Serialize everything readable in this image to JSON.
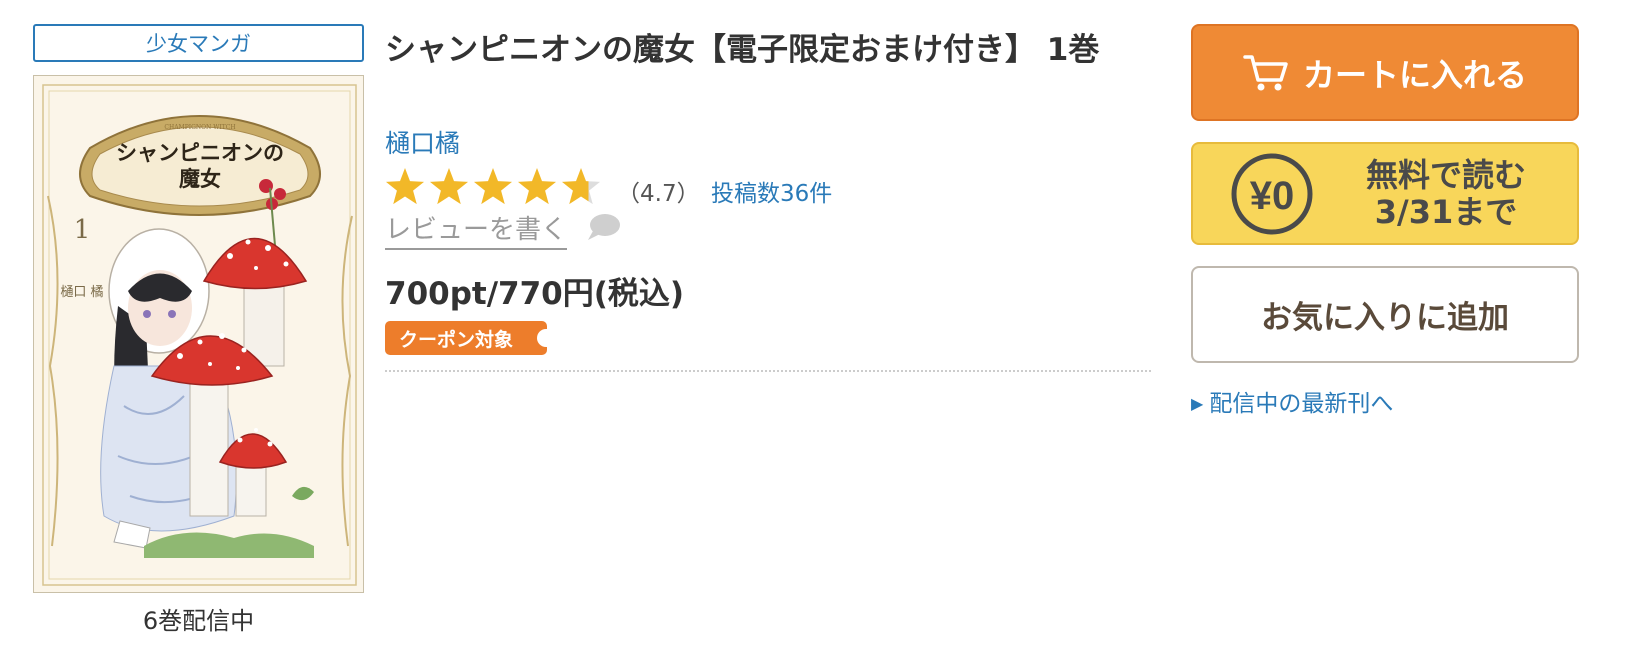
{
  "genre_badge": "少女マンガ",
  "volume_note": "6巻配信中",
  "cover": {
    "title_line1": "シャンピニオンの",
    "title_line2": "魔女",
    "subtitle": "CHAMPIGNON WITCH",
    "volume_number": "1",
    "author_vertical": "樋口 橘"
  },
  "product": {
    "title": "シャンピニオンの魔女【電子限定おまけ付き】 1巻",
    "author": "樋口橘",
    "rating_value": 4.7,
    "rating_text": "（4.7）",
    "review_count_text": "投稿数36件",
    "write_review": "レビューを書く",
    "price": "700pt/770円(税込)",
    "coupon_badge": "クーポン対象"
  },
  "actions": {
    "cart_label": "カートに入れる",
    "free_icon_text": "¥0",
    "free_line1": "無料で読む",
    "free_line2": "3/31まで",
    "favorite_label": "お気に入りに追加",
    "latest_link": "配信中の最新刊へ",
    "latest_arrow": "▶"
  },
  "colors": {
    "link_blue": "#2a7ab8",
    "cart_orange": "#ef8a35",
    "free_yellow": "#f8d65a",
    "star_gold": "#f2b828",
    "star_empty": "#dddddd",
    "coupon_orange": "#ed7d2b"
  }
}
